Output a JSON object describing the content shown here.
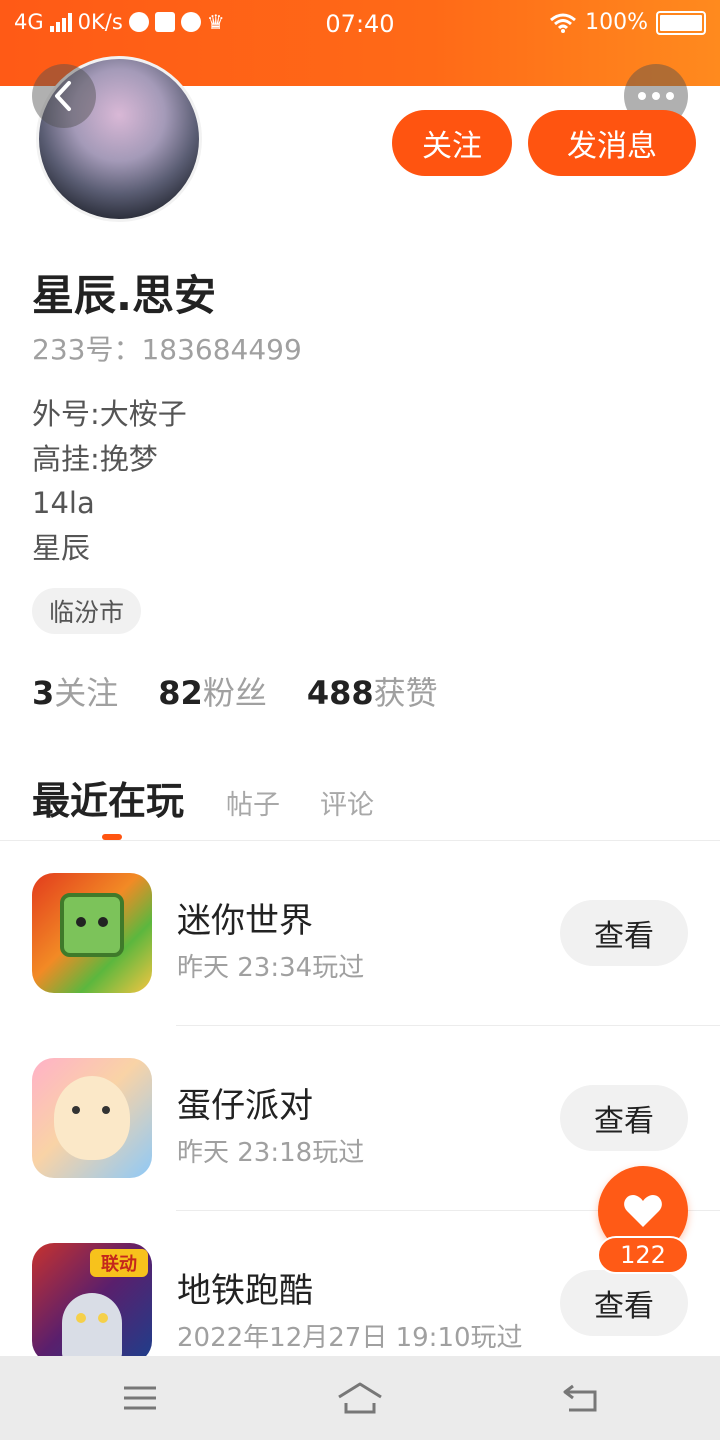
{
  "status_bar": {
    "network": "4G",
    "speed": "0K/s",
    "time": "07:40",
    "battery": "100%"
  },
  "profile": {
    "name": "星辰.思安",
    "uid_label": "233号：",
    "uid": "183684499",
    "bio_lines": [
      "外号:大桉子",
      "高挂:挽梦",
      "14la",
      "星辰"
    ],
    "location": "临汾市",
    "stats": [
      {
        "num": "3",
        "label": "关注"
      },
      {
        "num": "82",
        "label": "粉丝"
      },
      {
        "num": "488",
        "label": "获赞"
      }
    ]
  },
  "actions": {
    "follow": "关注",
    "message": "发消息"
  },
  "tabs": [
    {
      "label": "最近在玩",
      "active": true
    },
    {
      "label": "帖子",
      "active": false
    },
    {
      "label": "评论",
      "active": false
    }
  ],
  "games": [
    {
      "name": "迷你世界",
      "time": "昨天 23:34玩过",
      "button": "查看"
    },
    {
      "name": "蛋仔派对",
      "time": "昨天 23:18玩过",
      "button": "查看"
    },
    {
      "name": "地铁跑酷",
      "time": "2022年12月27日 19:10玩过",
      "button": "查看"
    }
  ],
  "game3_badge": "联动",
  "like": {
    "count": "122"
  },
  "icons": {
    "back": "chevron-left-icon",
    "more": "more-dots-icon",
    "like": "heart-icon",
    "nav_menu": "menu-icon",
    "nav_home": "home-icon",
    "nav_back": "back-icon"
  },
  "colors": {
    "accent": "#ff5410",
    "status_bar": "#ff6a17"
  }
}
